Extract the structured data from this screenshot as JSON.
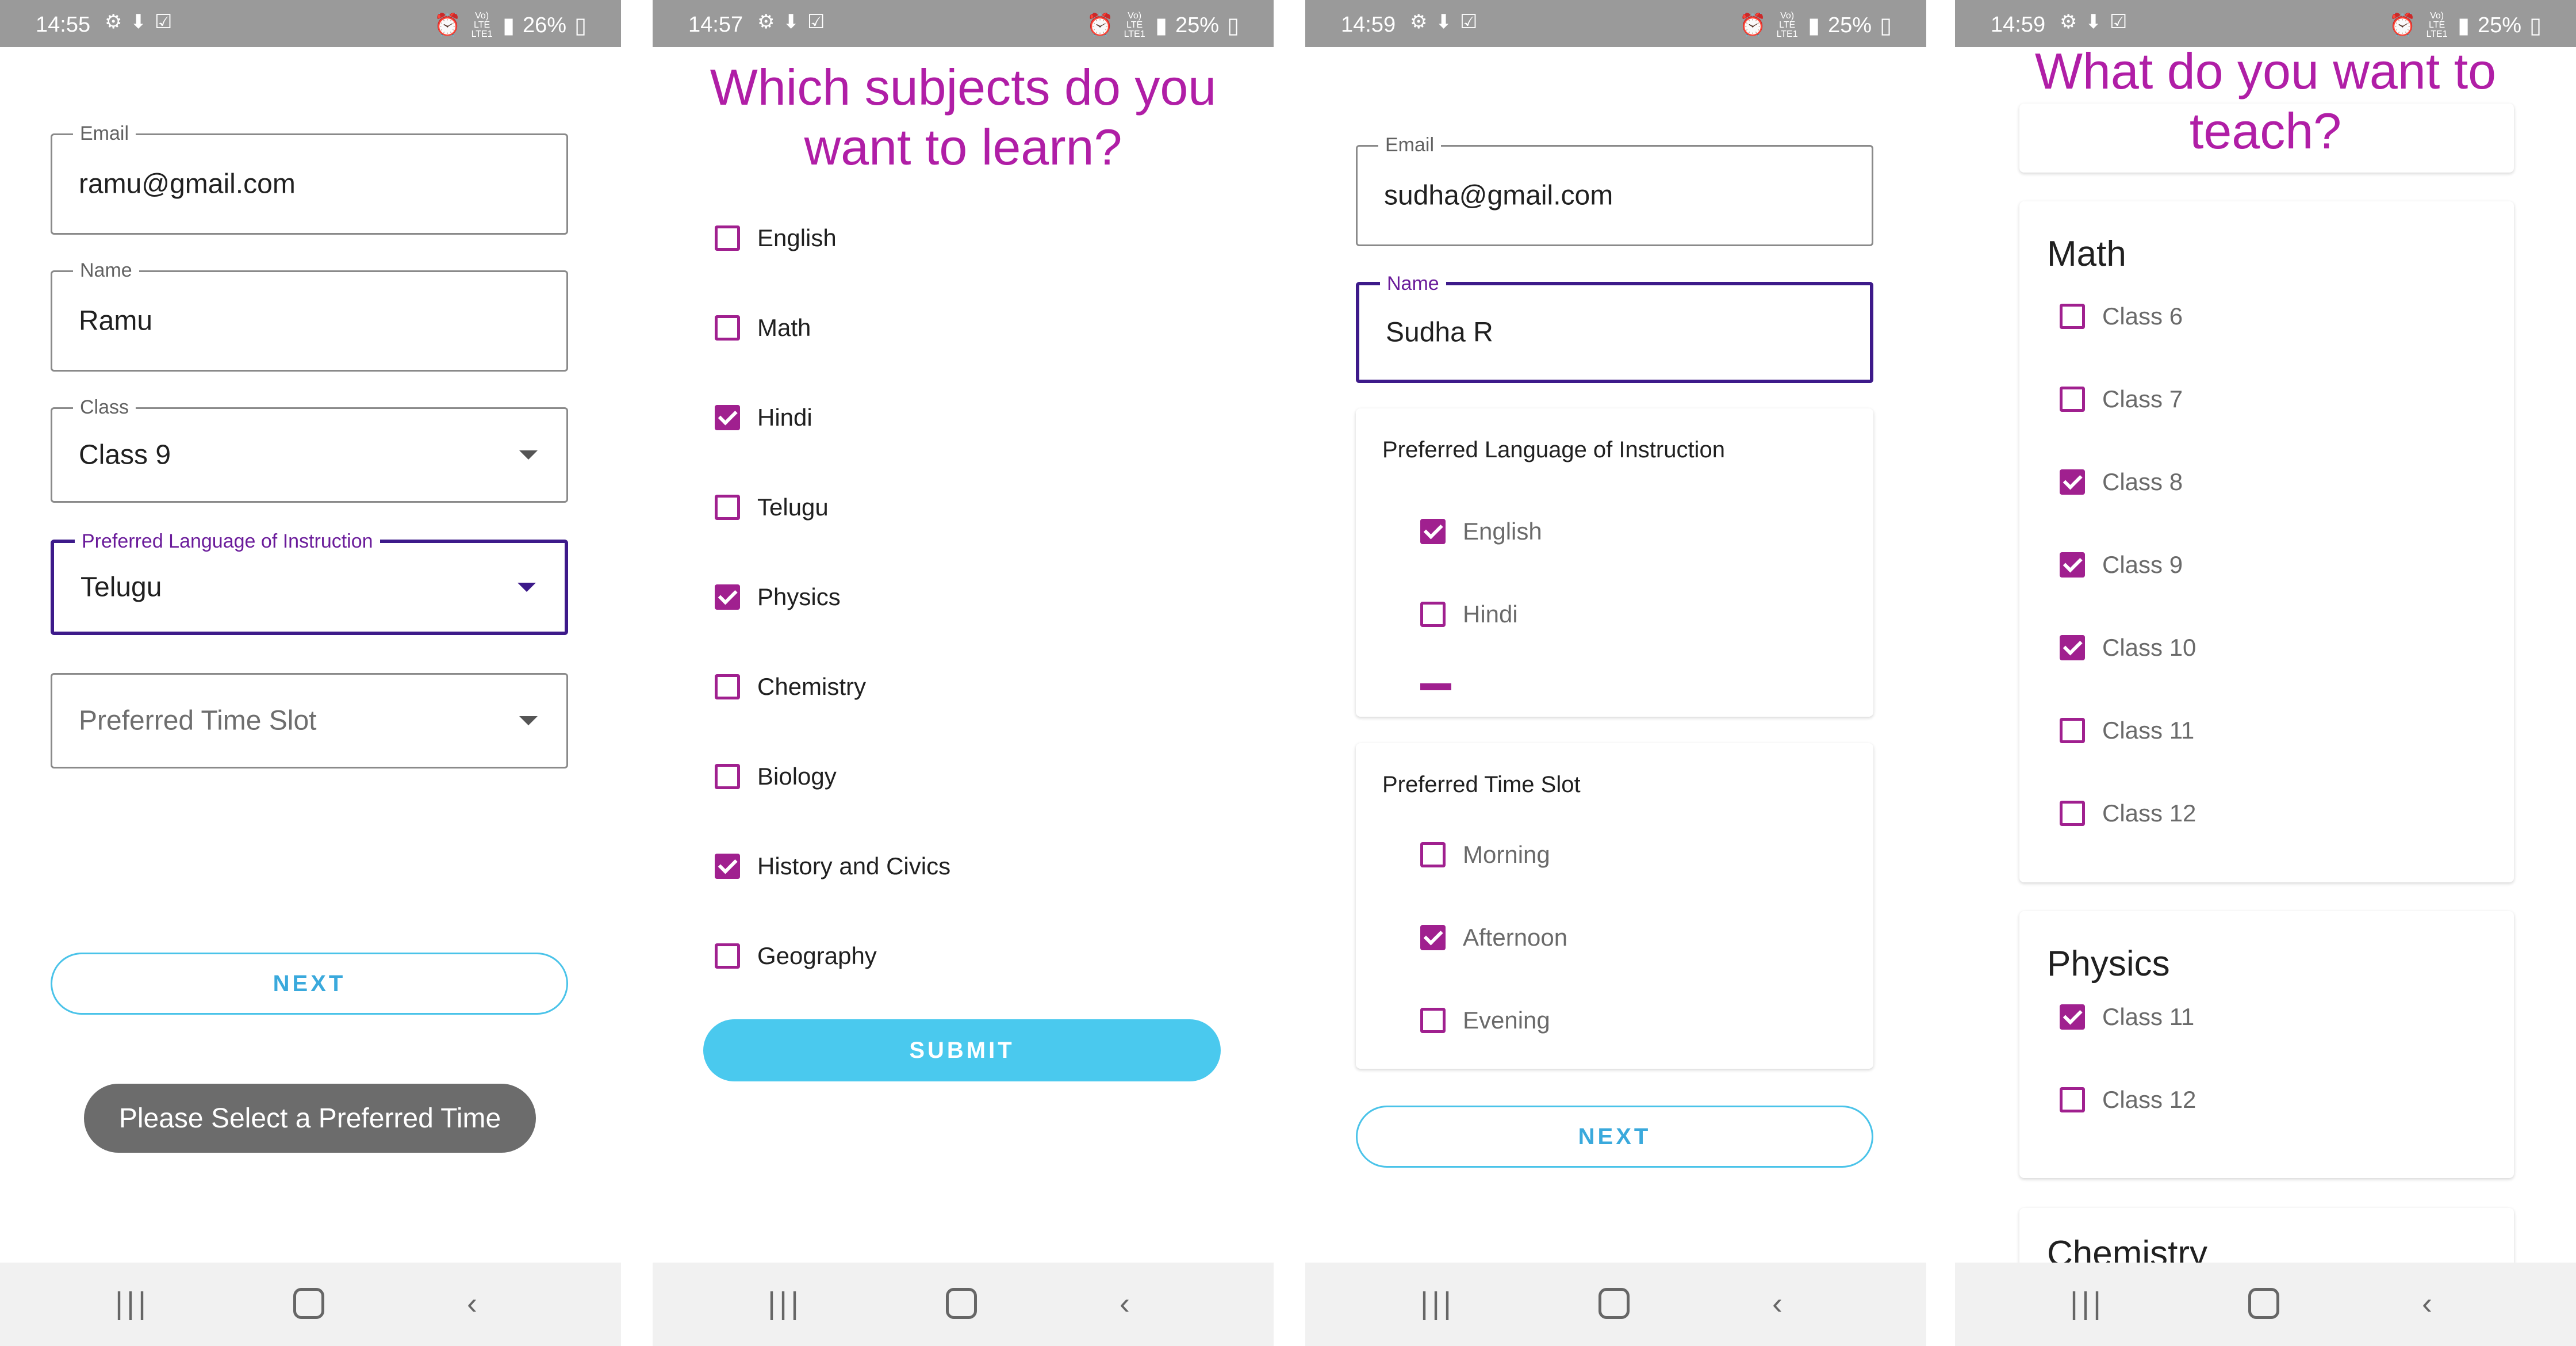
{
  "screens": [
    {
      "status": {
        "time": "14:55",
        "battery": "26%",
        "network": "Vo) LTE LTE1"
      },
      "email": {
        "label": "Email",
        "value": "ramu@gmail.com"
      },
      "name": {
        "label": "Name",
        "value": "Ramu"
      },
      "class": {
        "label": "Class",
        "value": "Class 9"
      },
      "language": {
        "label": "Preferred Language of Instruction",
        "value": "Telugu"
      },
      "time_slot": {
        "placeholder": "Preferred Time Slot"
      },
      "next_label": "NEXT",
      "toast": "Please Select a Preferred Time"
    },
    {
      "status": {
        "time": "14:57",
        "battery": "25%",
        "network": "Vo) LTE LTE1"
      },
      "heading_line1": "Which subjects do you",
      "heading_line2": "want to learn?",
      "subjects": [
        {
          "label": "English",
          "checked": false
        },
        {
          "label": "Math",
          "checked": false
        },
        {
          "label": "Hindi",
          "checked": true
        },
        {
          "label": "Telugu",
          "checked": false
        },
        {
          "label": "Physics",
          "checked": true
        },
        {
          "label": "Chemistry",
          "checked": false
        },
        {
          "label": "Biology",
          "checked": false
        },
        {
          "label": "History and Civics",
          "checked": true
        },
        {
          "label": "Geography",
          "checked": false
        }
      ],
      "submit_label": "SUBMIT"
    },
    {
      "status": {
        "time": "14:59",
        "battery": "25%",
        "network": "Vo) LTE LTE1"
      },
      "email": {
        "label": "Email",
        "value": "sudha@gmail.com"
      },
      "name": {
        "label": "Name",
        "value": "Sudha R"
      },
      "language_card": {
        "title": "Preferred Language of Instruction",
        "options": [
          {
            "label": "English",
            "checked": true
          },
          {
            "label": "Hindi",
            "checked": false
          }
        ]
      },
      "time_card": {
        "title": "Preferred Time Slot",
        "options": [
          {
            "label": "Morning",
            "checked": false
          },
          {
            "label": "Afternoon",
            "checked": true
          },
          {
            "label": "Evening",
            "checked": false
          }
        ]
      },
      "next_label": "NEXT"
    },
    {
      "status": {
        "time": "14:59",
        "battery": "25%",
        "network": "Vo) LTE LTE1"
      },
      "heading_line1": "What do you want to",
      "heading_line2": "teach?",
      "math": {
        "title": "Math",
        "options": [
          {
            "label": "Class 6",
            "checked": false
          },
          {
            "label": "Class 7",
            "checked": false
          },
          {
            "label": "Class 8",
            "checked": true
          },
          {
            "label": "Class 9",
            "checked": true
          },
          {
            "label": "Class 10",
            "checked": true
          },
          {
            "label": "Class 11",
            "checked": false
          },
          {
            "label": "Class 12",
            "checked": false
          }
        ]
      },
      "physics": {
        "title": "Physics",
        "options": [
          {
            "label": "Class 11",
            "checked": true
          },
          {
            "label": "Class 12",
            "checked": false
          }
        ]
      },
      "chemistry": {
        "title": "Chemistry"
      }
    }
  ]
}
